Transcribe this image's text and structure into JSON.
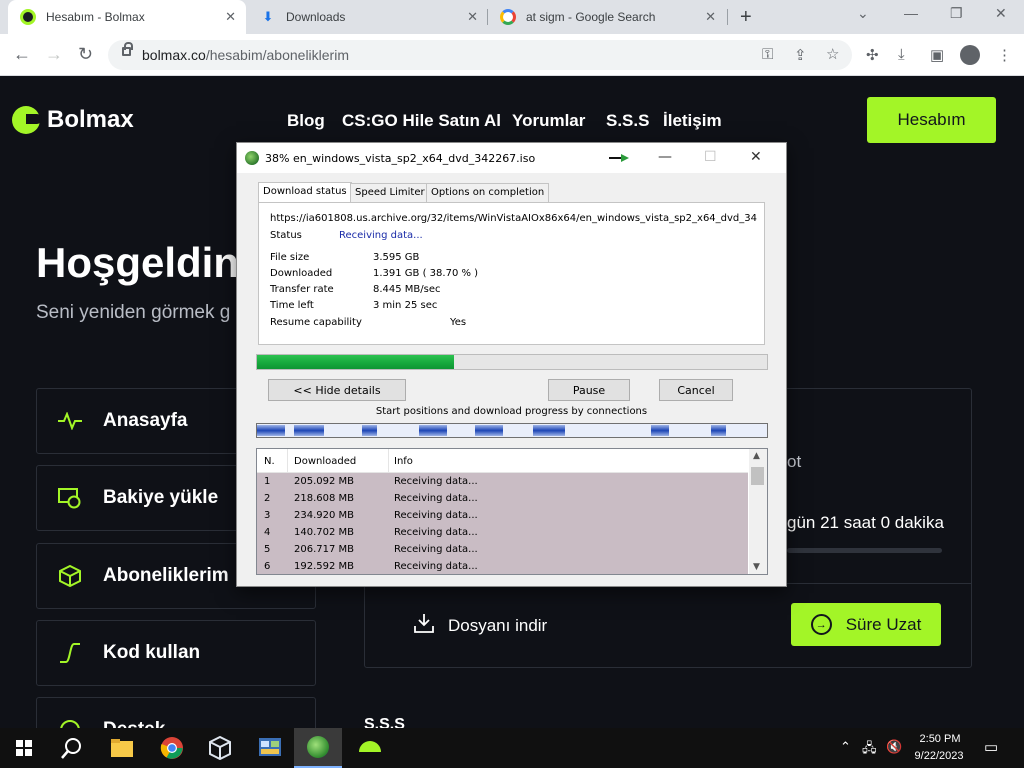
{
  "browser": {
    "tabs": [
      {
        "title": "Hesabım - Bolmax",
        "favicon": "bolmax-icon",
        "active": true
      },
      {
        "title": "Downloads",
        "favicon": "download-icon",
        "active": false
      },
      {
        "title": "at sigm - Google Search",
        "favicon": "google-icon",
        "active": false
      }
    ],
    "url_host": "bolmax.co",
    "url_path": "/hesabim/aboneliklerim"
  },
  "site": {
    "logo_text": "Bolmax",
    "nav": [
      "Blog",
      "CS:GO Hile Satın Al",
      "Yorumlar",
      "S.S.S",
      "İletişim"
    ],
    "account_button": "Hesabım",
    "welcome": "Hoşgeldin",
    "subtext": "Seni yeniden görmek g",
    "sidebar": [
      {
        "label": "Anasayfa",
        "icon": "activity-icon"
      },
      {
        "label": "Bakiye yükle",
        "icon": "wallet-icon"
      },
      {
        "label": "Aboneliklerim",
        "icon": "box-icon"
      },
      {
        "label": "Kod kullan",
        "icon": "curve-icon"
      },
      {
        "label": "Destek",
        "icon": "support-icon"
      }
    ],
    "card": {
      "partial_label": "ot",
      "remaining": "gün 21 saat 0 dakika",
      "download_label": "Dosyanı indir",
      "extend_button": "Süre Uzat"
    },
    "footer_partial": "S.S.S",
    "accent": "#a3f527"
  },
  "idm": {
    "title": "38% en_windows_vista_sp2_x64_dvd_342267.iso",
    "tabs": [
      "Download status",
      "Speed Limiter",
      "Options on completion"
    ],
    "url": "https://ia601808.us.archive.org/32/items/WinVistaAIOx86x64/en_windows_vista_sp2_x64_dvd_34",
    "status_label": "Status",
    "status_value": "Receiving data...",
    "fields": [
      {
        "label": "File size",
        "value": "3.595  GB"
      },
      {
        "label": "Downloaded",
        "value": "1.391  GB  ( 38.70 % )"
      },
      {
        "label": "Transfer rate",
        "value": "8.445  MB/sec"
      },
      {
        "label": "Time left",
        "value": "3 min 25 sec"
      },
      {
        "label": "Resume capability",
        "value": "Yes"
      }
    ],
    "progress_fraction": 0.387,
    "buttons": {
      "hide": "<< Hide details",
      "pause": "Pause",
      "cancel": "Cancel"
    },
    "connections_label": "Start positions and download progress by connections",
    "columns": [
      "N.",
      "Downloaded",
      "Info"
    ],
    "rows": [
      {
        "n": "1",
        "downloaded": "205.092  MB",
        "info": "Receiving data..."
      },
      {
        "n": "2",
        "downloaded": "218.608  MB",
        "info": "Receiving data..."
      },
      {
        "n": "3",
        "downloaded": "234.920  MB",
        "info": "Receiving data..."
      },
      {
        "n": "4",
        "downloaded": "140.702  MB",
        "info": "Receiving data..."
      },
      {
        "n": "5",
        "downloaded": "206.717  MB",
        "info": "Receiving data..."
      },
      {
        "n": "6",
        "downloaded": "192.592  MB",
        "info": "Receiving data..."
      }
    ]
  },
  "taskbar": {
    "time": "2:50 PM",
    "date": "9/22/2023",
    "apps": [
      "start-icon",
      "search-icon",
      "file-explorer-icon",
      "chrome-icon",
      "virtualbox-icon",
      "control-panel-icon",
      "idm-icon",
      "bolmax-app-icon"
    ]
  }
}
